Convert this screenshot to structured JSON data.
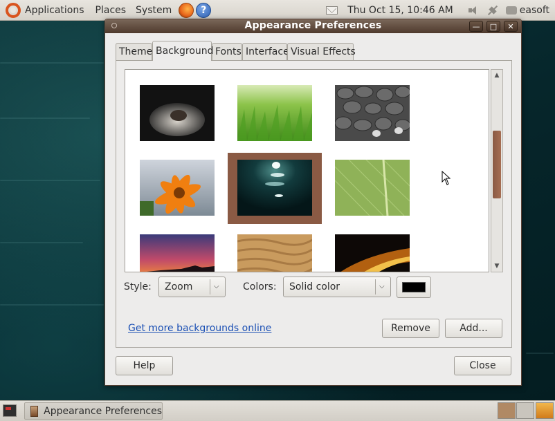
{
  "top_panel": {
    "menus": [
      "Applications",
      "Places",
      "System"
    ],
    "datetime": "Thu Oct 15, 10:46 AM",
    "username": "easoft",
    "icons": [
      "ubuntu-logo",
      "firefox-icon",
      "help-icon",
      "mail-icon",
      "volume-icon",
      "network-icon",
      "chat-icon"
    ]
  },
  "window": {
    "title": "Appearance Preferences",
    "tabs": [
      {
        "label": "Theme",
        "active": false
      },
      {
        "label": "Background",
        "active": true
      },
      {
        "label": "Fonts",
        "active": false
      },
      {
        "label": "Interface",
        "active": false
      },
      {
        "label": "Visual Effects",
        "active": false
      }
    ],
    "wallpapers": [
      {
        "name": "hands-with-seeds"
      },
      {
        "name": "green-grass"
      },
      {
        "name": "cobblestone-shoes"
      },
      {
        "name": "orange-flower"
      },
      {
        "name": "dark-water-sparkle",
        "selected": true
      },
      {
        "name": "green-leaf"
      },
      {
        "name": "sunset-sky"
      },
      {
        "name": "sand-dunes"
      },
      {
        "name": "fire-glow"
      }
    ],
    "style_label": "Style:",
    "style_value": "Zoom",
    "colors_label": "Colors:",
    "colors_value": "Solid color",
    "color_swatch": "#000000",
    "link_text": "Get more backgrounds online",
    "remove_label": "Remove",
    "add_label": "Add...",
    "help_label": "Help",
    "close_label": "Close"
  },
  "taskbar": {
    "task_label": "Appearance Preferences"
  },
  "colors": {
    "title_bar": "#5b4637",
    "selection": "#8a5a44",
    "link": "#1a4fb4"
  }
}
